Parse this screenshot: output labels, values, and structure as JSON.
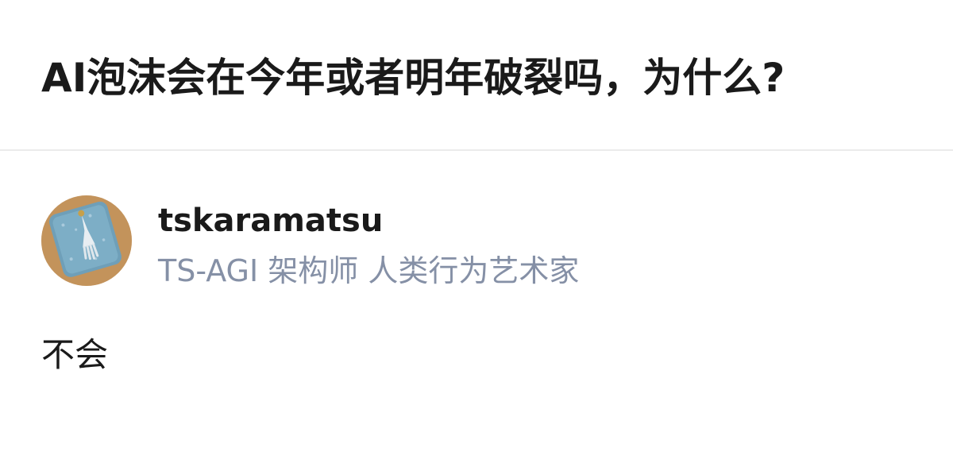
{
  "question": {
    "title": "AI泡沫会在今年或者明年破裂吗，为什么?"
  },
  "answer": {
    "author": {
      "name": "tskaramatsu",
      "bio": "TS-AGI 架构师 人类行为艺术家"
    },
    "content": "不会"
  }
}
